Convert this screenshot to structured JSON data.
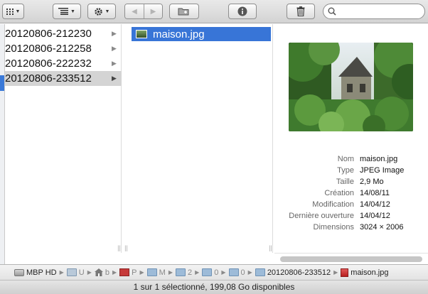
{
  "toolbar": {
    "view_icon": "grid-view-icon",
    "arrange_icon": "list-arrange-icon",
    "action_icon": "gear-icon",
    "back_icon": "back-arrow-icon",
    "forward_icon": "forward-arrow-icon",
    "new_folder_icon": "new-folder-icon",
    "info_icon": "info-icon",
    "trash_icon": "trash-icon",
    "search_placeholder": ""
  },
  "column1": {
    "items": [
      {
        "name": "20120806-212230",
        "selected": false
      },
      {
        "name": "20120806-212258",
        "selected": false
      },
      {
        "name": "20120806-222232",
        "selected": false
      },
      {
        "name": "20120806-233512",
        "selected": true
      }
    ]
  },
  "column2": {
    "items": [
      {
        "name": "maison.jpg",
        "selected": true
      }
    ]
  },
  "preview": {
    "info": [
      {
        "key": "Nom",
        "value": "maison.jpg"
      },
      {
        "key": "Type",
        "value": "JPEG Image"
      },
      {
        "key": "Taille",
        "value": "2,9 Mo"
      },
      {
        "key": "Création",
        "value": "14/08/11"
      },
      {
        "key": "Modification",
        "value": "14/04/12"
      },
      {
        "key": "Dernière ouverture",
        "value": "14/04/12"
      },
      {
        "key": "Dimensions",
        "value": "3024 × 2006"
      }
    ]
  },
  "pathbar": {
    "disk": "MBP HD",
    "c1": "U",
    "c2": "b",
    "c3": "P",
    "c4": "M",
    "c5": "2",
    "c6": "0",
    "c7": "0",
    "folder": "20120806-233512",
    "file": "maison.jpg"
  },
  "status": "1 sur 1 sélectionné, 199,08 Go disponibles",
  "colors": {
    "selection": "#3875d7",
    "inactive_selection": "#d4d4d4"
  }
}
